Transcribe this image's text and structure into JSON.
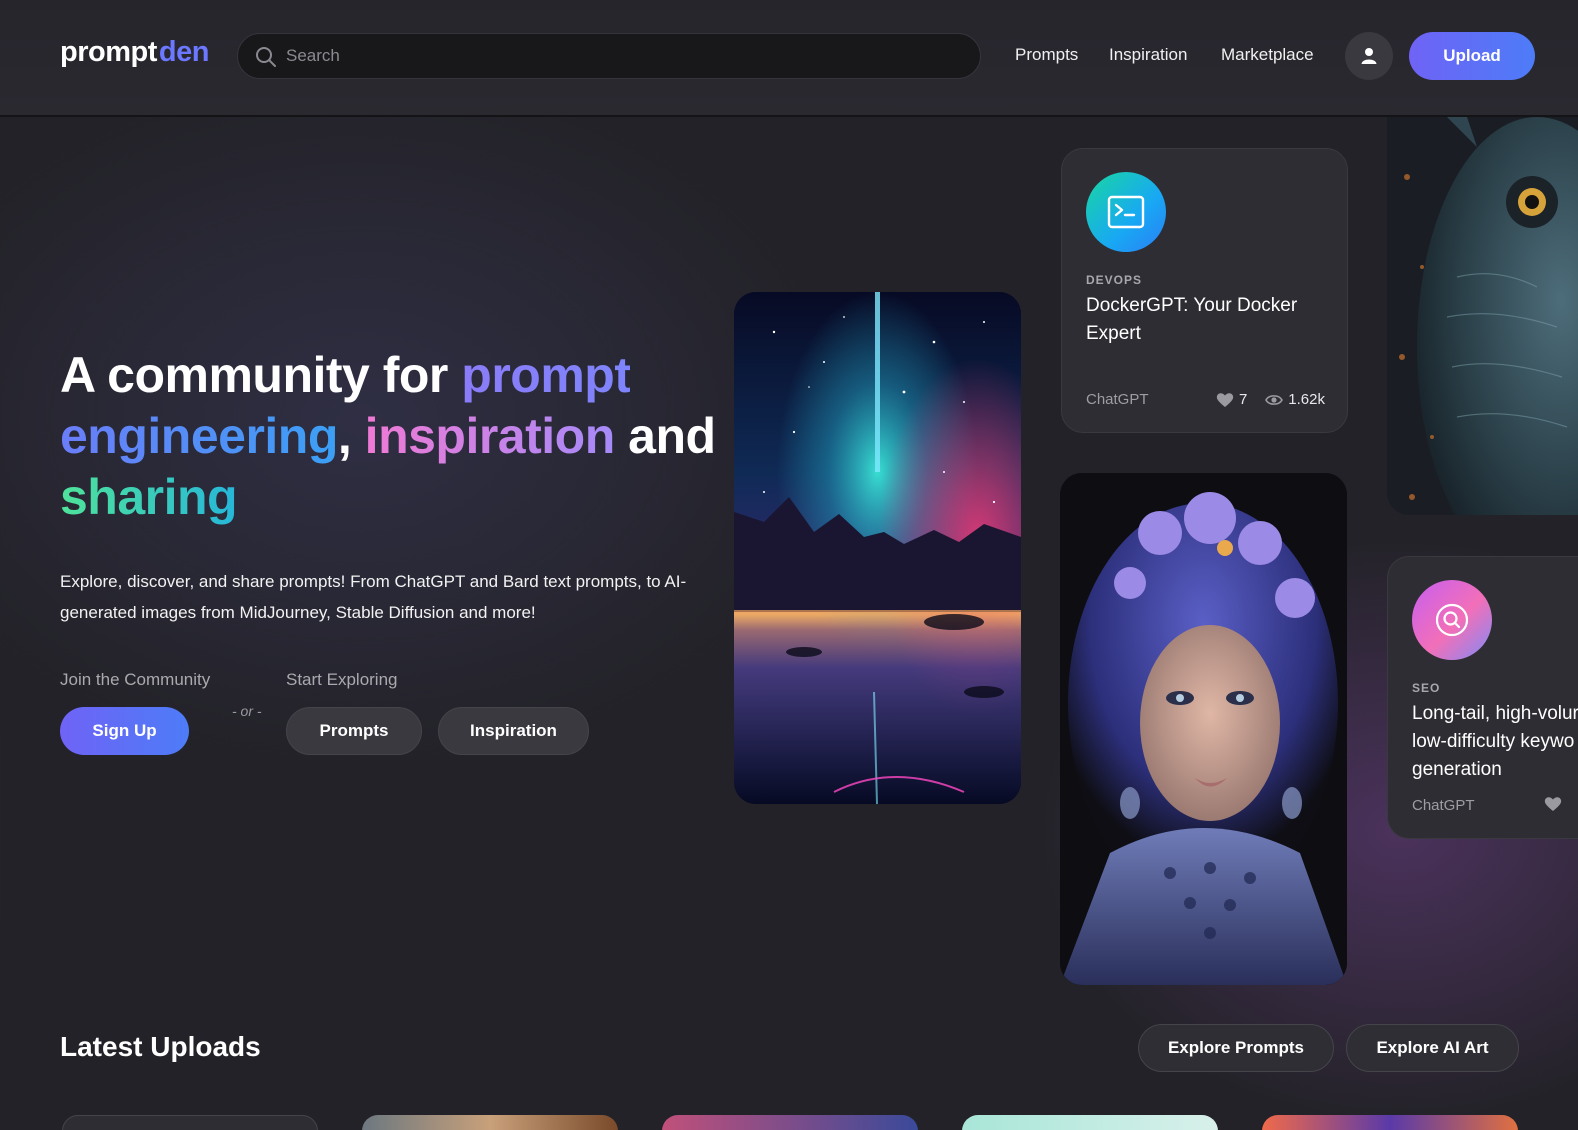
{
  "header": {
    "logo_part1": "prompt",
    "logo_part2": "den",
    "search_placeholder": "Search",
    "nav": [
      "Prompts",
      "Inspiration",
      "Marketplace"
    ],
    "upload_label": "Upload",
    "icons": {
      "search": "search-icon",
      "user": "user-icon"
    }
  },
  "hero": {
    "title": {
      "w1": "A community for ",
      "w2": "prompt",
      "w3": "engineering",
      "w4": ", ",
      "w5": "inspiration",
      "w6": " and",
      "w7": "sharing"
    },
    "description": "Explore, discover, and share prompts! From ChatGPT and Bard text prompts, to AI-generated images from MidJourney, Stable Diffusion and more!",
    "join_label": "Join the Community",
    "or_label": "- or -",
    "explore_label": "Start Exploring",
    "signup_button": "Sign Up",
    "prompts_button": "Prompts",
    "inspiration_button": "Inspiration"
  },
  "cards": {
    "docker": {
      "category": "DEVOPS",
      "title": "DockerGPT: Your Docker Expert",
      "platform": "ChatGPT",
      "likes": "7",
      "views": "1.62k",
      "icon": "terminal-icon"
    },
    "seo": {
      "category": "SEO",
      "title_line1": "Long-tail, high-volur",
      "title_line2": "low-difficulty keywo",
      "title_line3": "generation",
      "platform": "ChatGPT",
      "icon": "search-icon"
    }
  },
  "latest": {
    "title": "Latest Uploads",
    "explore_prompts": "Explore Prompts",
    "explore_art": "Explore AI Art"
  },
  "colors": {
    "accent_start": "#6f63f6",
    "accent_end": "#4d7cf7",
    "background": "#232228",
    "card": "#2e2d33"
  }
}
